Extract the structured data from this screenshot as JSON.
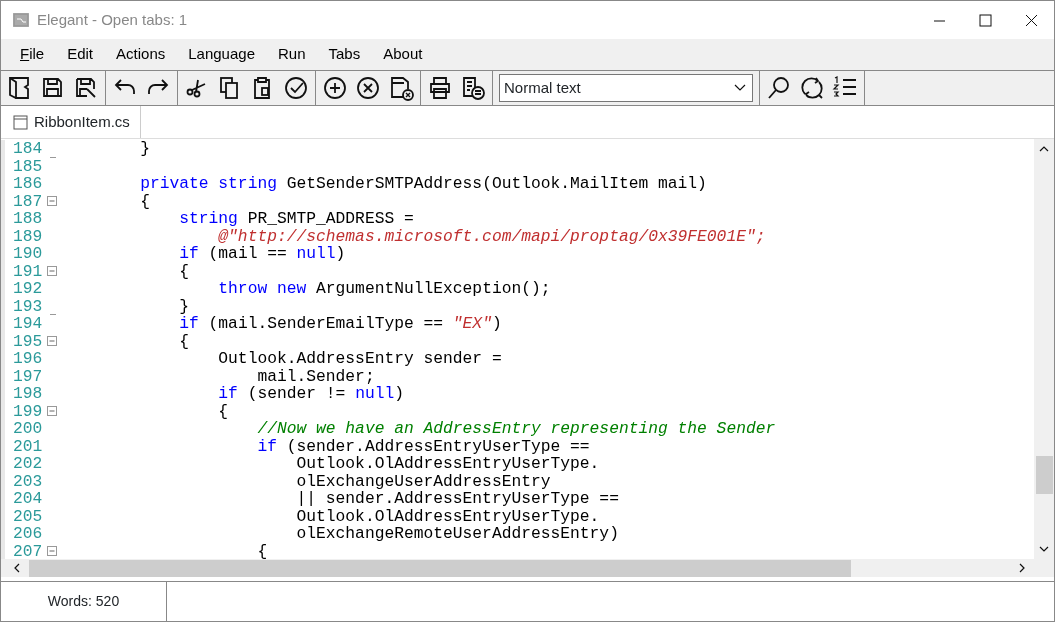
{
  "window": {
    "title": "Elegant - Open tabs: 1"
  },
  "menu": [
    {
      "accel_key": "F",
      "rest": "ile"
    },
    {
      "label": "Edit"
    },
    {
      "label": "Actions"
    },
    {
      "label": "Language"
    },
    {
      "label": "Run"
    },
    {
      "label": "Tabs"
    },
    {
      "label": "About"
    }
  ],
  "toolbar": {
    "style_dropdown": {
      "value": "Normal text"
    }
  },
  "tabs": [
    {
      "label": "RibbonItem.cs",
      "selected": true
    }
  ],
  "editor": {
    "lines": [
      {
        "number": "184",
        "fold_end": true,
        "segments": [
          {
            "kind": "plain",
            "text": "        }"
          }
        ]
      },
      {
        "number": "185"
      },
      {
        "number": "186",
        "segments": [
          {
            "kind": "keyword",
            "text": "        private string"
          },
          {
            "kind": "plain",
            "text": " GetSenderSMTPAddress(Outlook.MailItem mail)"
          }
        ]
      },
      {
        "number": "187",
        "fold_marker": true,
        "segments": [
          {
            "kind": "plain",
            "text": "        {"
          }
        ]
      },
      {
        "number": "188",
        "segments": [
          {
            "kind": "keyword",
            "text": "            string"
          },
          {
            "kind": "plain",
            "text": " PR_SMTP_ADDRESS ="
          }
        ]
      },
      {
        "number": "189",
        "segments": [
          {
            "kind": "string",
            "text": "                @\"http://schemas.microsoft.com/mapi/proptag/0x39FE001E\";"
          }
        ]
      },
      {
        "number": "190",
        "segments": [
          {
            "kind": "keyword",
            "text": "            if"
          },
          {
            "kind": "plain",
            "text": " (mail == "
          },
          {
            "kind": "keyword",
            "text": "null"
          },
          {
            "kind": "plain",
            "text": ")"
          }
        ]
      },
      {
        "number": "191",
        "fold_marker": true,
        "segments": [
          {
            "kind": "plain",
            "text": "            {"
          }
        ]
      },
      {
        "number": "192",
        "segments": [
          {
            "kind": "keyword",
            "text": "                throw new"
          },
          {
            "kind": "plain",
            "text": " ArgumentNullException();"
          }
        ]
      },
      {
        "number": "193",
        "fold_end": true,
        "segments": [
          {
            "kind": "plain",
            "text": "            }"
          }
        ]
      },
      {
        "number": "194",
        "segments": [
          {
            "kind": "keyword",
            "text": "            if"
          },
          {
            "kind": "plain",
            "text": " (mail.SenderEmailType == "
          },
          {
            "kind": "string",
            "text": "\"EX\""
          },
          {
            "kind": "plain",
            "text": ")"
          }
        ]
      },
      {
        "number": "195",
        "fold_marker": true,
        "segments": [
          {
            "kind": "plain",
            "text": "            {"
          }
        ]
      },
      {
        "number": "196",
        "segments": [
          {
            "kind": "plain",
            "text": "                Outlook.AddressEntry sender ="
          }
        ]
      },
      {
        "number": "197",
        "segments": [
          {
            "kind": "plain",
            "text": "                    mail.Sender;"
          }
        ]
      },
      {
        "number": "198",
        "segments": [
          {
            "kind": "keyword",
            "text": "                if"
          },
          {
            "kind": "plain",
            "text": " (sender != "
          },
          {
            "kind": "keyword",
            "text": "null"
          },
          {
            "kind": "plain",
            "text": ")"
          }
        ]
      },
      {
        "number": "199",
        "fold_marker": true,
        "segments": [
          {
            "kind": "plain",
            "text": "                {"
          }
        ]
      },
      {
        "number": "200",
        "segments": [
          {
            "kind": "comment",
            "text": "                    //Now we have an AddressEntry representing the Sender"
          }
        ]
      },
      {
        "number": "201",
        "segments": [
          {
            "kind": "keyword",
            "text": "                    if"
          },
          {
            "kind": "plain",
            "text": " (sender.AddressEntryUserType =="
          }
        ]
      },
      {
        "number": "202",
        "segments": [
          {
            "kind": "plain",
            "text": "                        Outlook.OlAddressEntryUserType."
          }
        ]
      },
      {
        "number": "203",
        "segments": [
          {
            "kind": "plain",
            "text": "                        olExchangeUserAddressEntry"
          }
        ]
      },
      {
        "number": "204",
        "segments": [
          {
            "kind": "plain",
            "text": "                        || sender.AddressEntryUserType =="
          }
        ]
      },
      {
        "number": "205",
        "segments": [
          {
            "kind": "plain",
            "text": "                        Outlook.OlAddressEntryUserType."
          }
        ]
      },
      {
        "number": "206",
        "segments": [
          {
            "kind": "plain",
            "text": "                        olExchangeRemoteUserAddressEntry)"
          }
        ]
      },
      {
        "number": "207",
        "fold_marker": true,
        "segments": [
          {
            "kind": "plain",
            "text": "                    {"
          }
        ]
      }
    ]
  },
  "status_bar": {
    "words": "Words: 520"
  }
}
